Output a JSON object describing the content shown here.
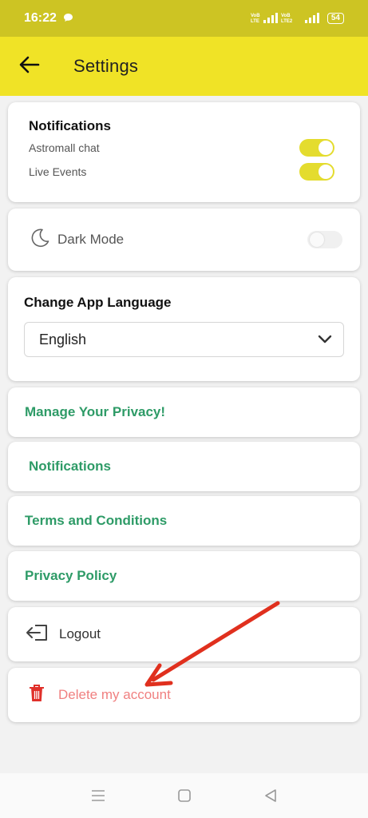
{
  "status": {
    "time": "16:22",
    "chat_icon": "chat-bubble-icon",
    "network1": "VoB LTE",
    "network2": "VoB LTE2",
    "battery": "54"
  },
  "header": {
    "title": "Settings",
    "back_icon": "arrow-left-icon",
    "bg_color": "#f0e326"
  },
  "notifications": {
    "title": "Notifications",
    "items": [
      {
        "label": "Astromall chat",
        "enabled": true
      },
      {
        "label": "Live Events",
        "enabled": true
      }
    ]
  },
  "dark_mode": {
    "label": "Dark Mode",
    "enabled": false,
    "icon": "moon-icon"
  },
  "language": {
    "title": "Change App Language",
    "selected": "English"
  },
  "links": [
    {
      "label": "Manage Your Privacy!"
    },
    {
      "label": "Notifications"
    },
    {
      "label": "Terms and Conditions"
    },
    {
      "label": "Privacy Policy"
    }
  ],
  "logout": {
    "label": "Logout",
    "icon": "logout-icon"
  },
  "delete": {
    "label": "Delete my account",
    "icon": "trash-icon"
  },
  "colors": {
    "accent": "#f0e326",
    "status_bar": "#cdc423",
    "link_green": "#2e9b67",
    "delete_red": "#f08080",
    "annotation_red": "#e0301e"
  }
}
